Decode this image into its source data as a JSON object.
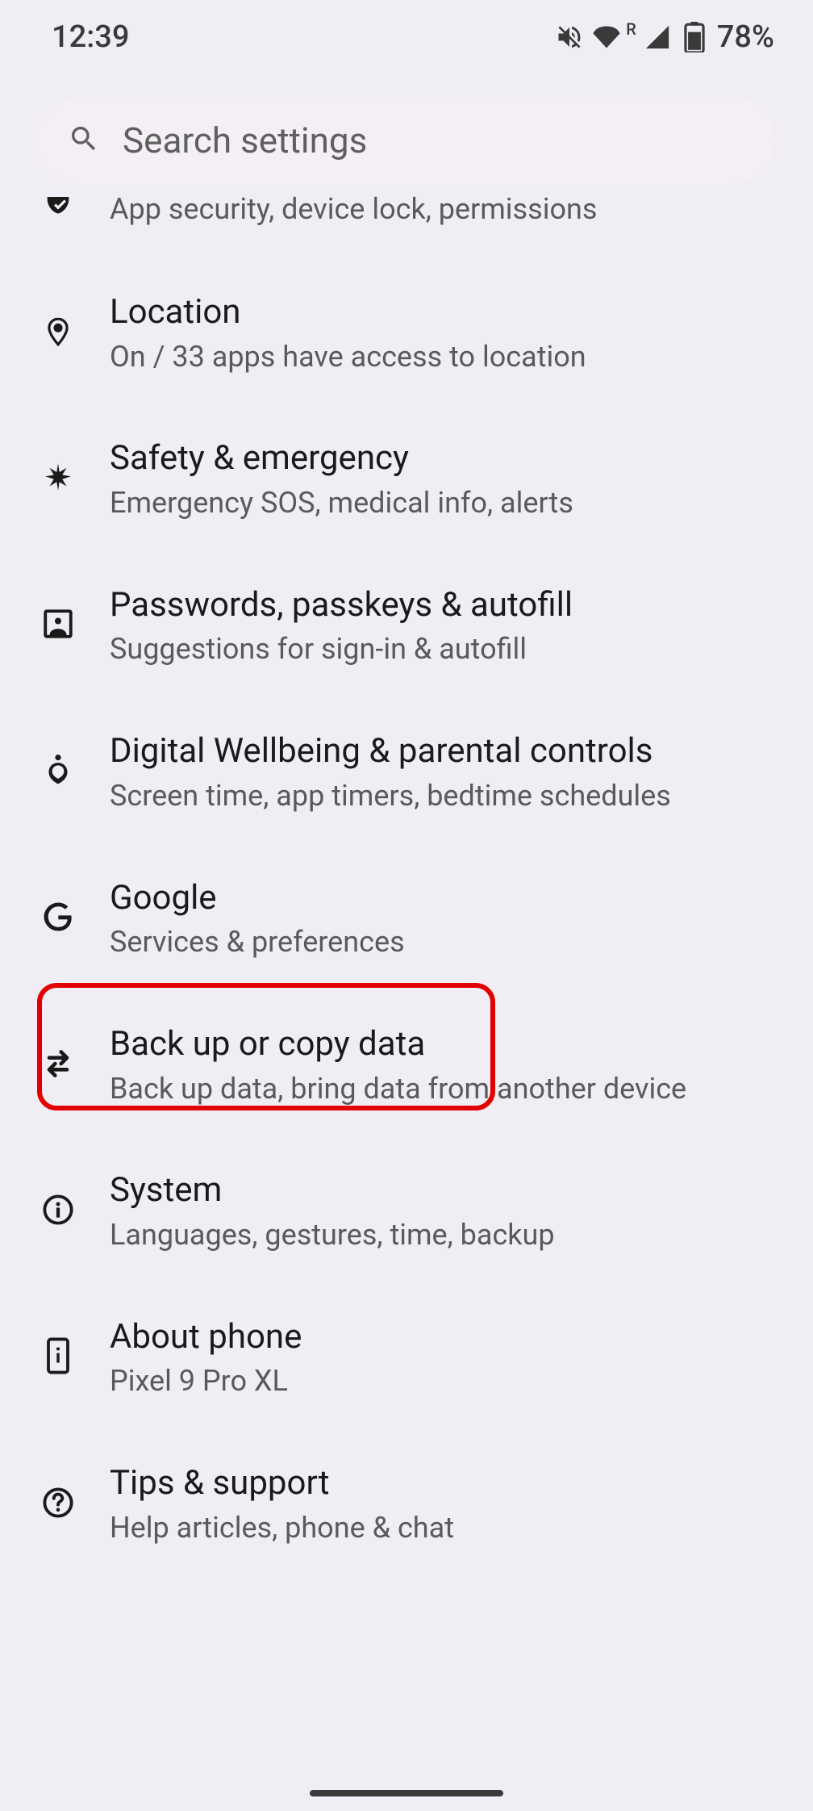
{
  "status_bar": {
    "time": "12:39",
    "battery_text": "78%",
    "roaming": "R"
  },
  "search": {
    "placeholder": "Search settings"
  },
  "items": [
    {
      "title": "",
      "subtitle": "App security, device lock, permissions"
    },
    {
      "title": "Location",
      "subtitle": "On / 33 apps have access to location"
    },
    {
      "title": "Safety & emergency",
      "subtitle": "Emergency SOS, medical info, alerts"
    },
    {
      "title": "Passwords, passkeys & autofill",
      "subtitle": "Suggestions for sign-in & autofill"
    },
    {
      "title": "Digital Wellbeing & parental controls",
      "subtitle": "Screen time, app timers, bedtime schedules"
    },
    {
      "title": "Google",
      "subtitle": "Services & preferences"
    },
    {
      "title": "Back up or copy data",
      "subtitle": "Back up data, bring data from another device"
    },
    {
      "title": "System",
      "subtitle": "Languages, gestures, time, backup"
    },
    {
      "title": "About phone",
      "subtitle": "Pixel 9 Pro XL"
    },
    {
      "title": "Tips & support",
      "subtitle": "Help articles, phone & chat"
    }
  ]
}
